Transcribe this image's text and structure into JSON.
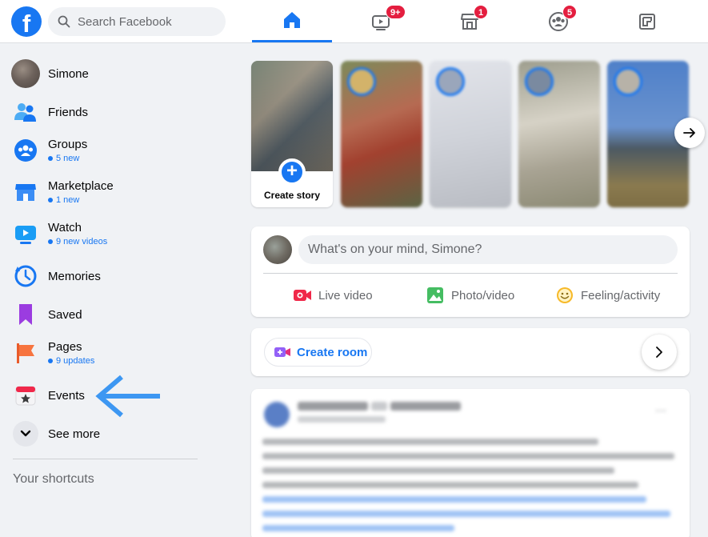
{
  "topbar": {
    "logo": "f",
    "search_placeholder": "Search Facebook",
    "tabs": [
      {
        "name": "home",
        "icon": "home-icon",
        "active": true,
        "badge": ""
      },
      {
        "name": "watch",
        "icon": "watch-icon",
        "active": false,
        "badge": "9+"
      },
      {
        "name": "marketplace",
        "icon": "marketplace-icon",
        "active": false,
        "badge": "1"
      },
      {
        "name": "groups",
        "icon": "groups-icon",
        "active": false,
        "badge": "5"
      },
      {
        "name": "gaming",
        "icon": "gaming-icon",
        "active": false,
        "badge": ""
      }
    ]
  },
  "sidebar": {
    "items": [
      {
        "label": "Simone",
        "sub": ""
      },
      {
        "label": "Friends",
        "sub": ""
      },
      {
        "label": "Groups",
        "sub": "5 new"
      },
      {
        "label": "Marketplace",
        "sub": "1 new"
      },
      {
        "label": "Watch",
        "sub": "9 new videos"
      },
      {
        "label": "Memories",
        "sub": ""
      },
      {
        "label": "Saved",
        "sub": ""
      },
      {
        "label": "Pages",
        "sub": "9 updates"
      },
      {
        "label": "Events",
        "sub": ""
      },
      {
        "label": "See more",
        "sub": ""
      }
    ],
    "shortcuts_title": "Your shortcuts"
  },
  "stories": {
    "create_label": "Create story"
  },
  "composer": {
    "placeholder": "What's on your mind, Simone?",
    "actions": [
      "Live video",
      "Photo/video",
      "Feeling/activity"
    ]
  },
  "room": {
    "label": "Create room"
  },
  "colors": {
    "brand": "#1877f2",
    "badge": "#e41e3f",
    "background": "#f0f2f5"
  }
}
